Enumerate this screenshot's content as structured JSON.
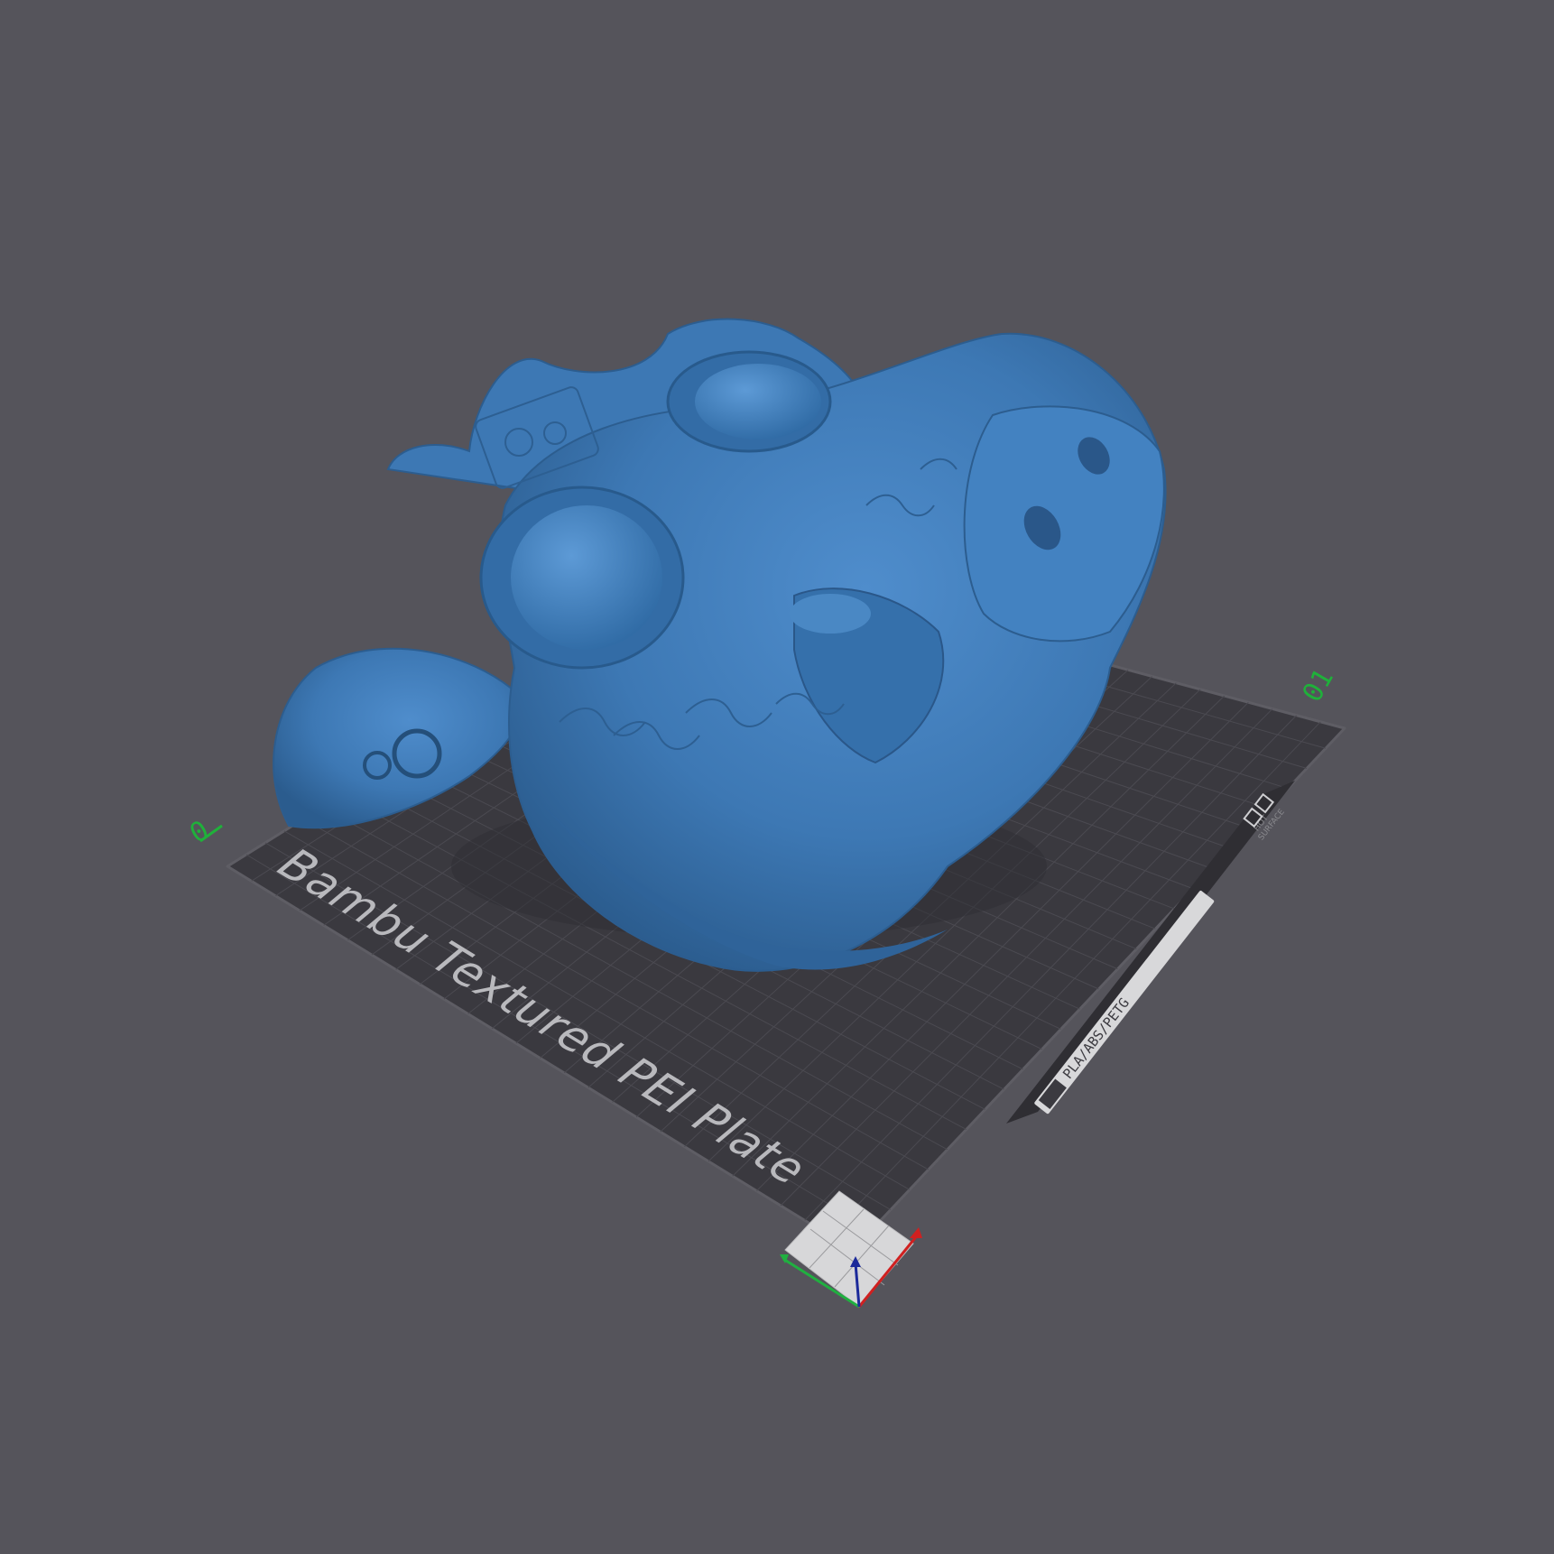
{
  "viewport": {
    "background_color": "#55545b"
  },
  "build_plate": {
    "label": "Bambu Textured PEI Plate",
    "surface_color": "#3a393f",
    "grid_color": "#4b4a51",
    "border_color": "#5e5d64",
    "origin_marker_left": "0",
    "origin_marker_right": "01",
    "sticker": {
      "material_text": "PLA/ABS/PETG",
      "warning_text_line1": "HOT",
      "warning_text_line2": "SURFACE"
    }
  },
  "model": {
    "description_icon": "creature-head-mesh",
    "color": "#3e79b5"
  },
  "axes_gizmo": {
    "x_color": "#d02020",
    "y_color": "#20b040",
    "z_color": "#1c2a9a"
  }
}
